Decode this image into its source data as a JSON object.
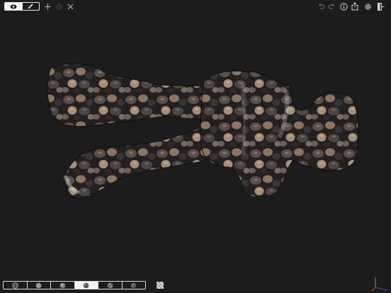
{
  "toolbar": {
    "left": [
      {
        "name": "view-mode-eye-icon",
        "active": true
      },
      {
        "name": "edit-mode-pencil-icon",
        "active": false
      },
      {
        "name": "move-icon"
      },
      {
        "name": "target-icon"
      },
      {
        "name": "symmetry-icon"
      }
    ],
    "right": [
      {
        "name": "undo-icon"
      },
      {
        "name": "redo-icon"
      },
      {
        "name": "info-icon"
      },
      {
        "name": "share-icon"
      },
      {
        "name": "gear-icon"
      },
      {
        "name": "exit-icon"
      }
    ]
  },
  "shading": {
    "modes": [
      "wireframe",
      "flat",
      "smooth",
      "matcap",
      "striped",
      "textured"
    ],
    "active_index": 3
  },
  "colors": {
    "background": "#1c1c1c",
    "accent": "#f2f2f2",
    "axis_x": "#e53935",
    "axis_y": "#43a047",
    "axis_z": "#3949ab"
  }
}
